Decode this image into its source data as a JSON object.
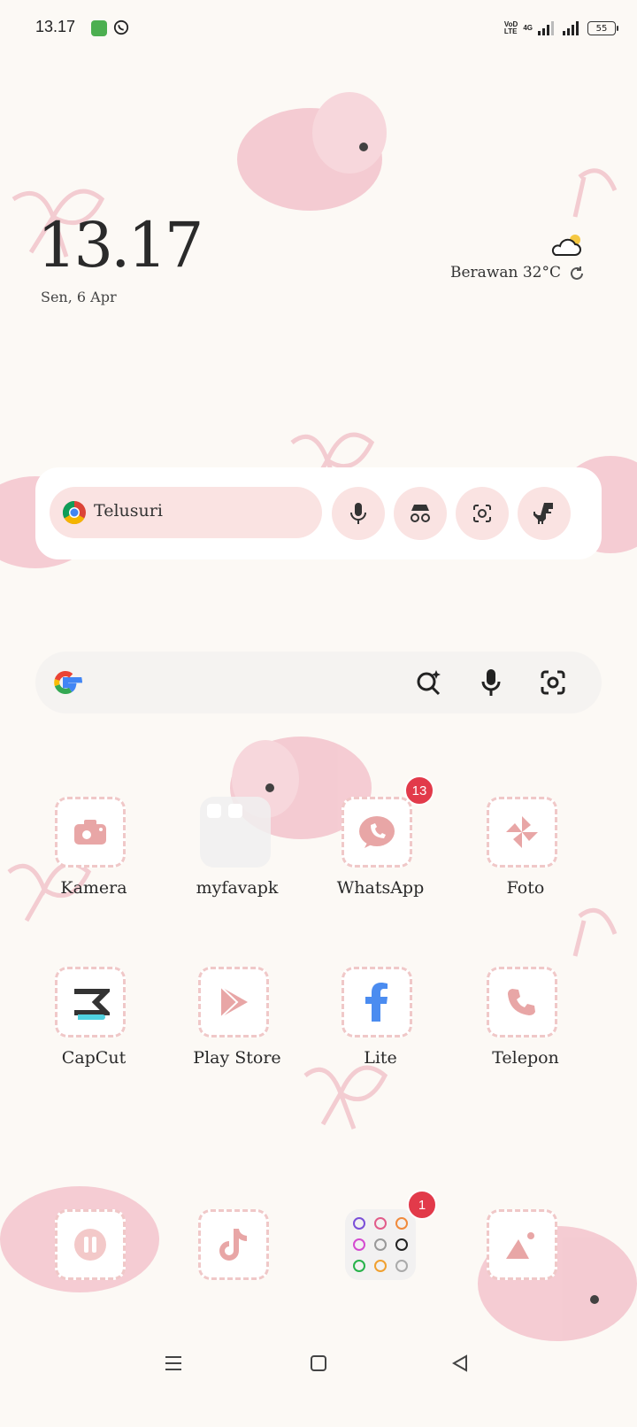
{
  "status_bar": {
    "time": "13.17",
    "volte_top": "VoD",
    "volte_bottom": "LTE",
    "network": "4G",
    "battery": "55"
  },
  "clock_widget": {
    "time": "13.17",
    "date": "Sen, 6 Apr",
    "weather": "Berawan 32°C"
  },
  "chrome_widget": {
    "search_label": "Telusuri",
    "buttons": [
      "mic-icon",
      "incognito-icon",
      "lens-icon",
      "dino-icon"
    ]
  },
  "google_bar": {
    "buttons": [
      "ai-search-icon",
      "mic-icon",
      "lens-icon"
    ]
  },
  "apps": [
    {
      "label": "Kamera",
      "icon": "camera-icon"
    },
    {
      "label": "myfavapk",
      "icon": "folder-icon"
    },
    {
      "label": "WhatsApp",
      "icon": "whatsapp-icon",
      "badge": "13"
    },
    {
      "label": "Foto",
      "icon": "pinwheel-icon"
    },
    {
      "label": "CapCut",
      "icon": "capcut-icon"
    },
    {
      "label": "Play Store",
      "icon": "play-store-icon"
    },
    {
      "label": "Lite",
      "icon": "facebook-icon"
    },
    {
      "label": "Telepon",
      "icon": "phone-icon"
    }
  ],
  "dock": [
    {
      "icon": "pause-icon"
    },
    {
      "icon": "tiktok-icon"
    },
    {
      "icon": "folder-icon",
      "badge": "1"
    },
    {
      "icon": "gallery-icon"
    }
  ],
  "nav": [
    "menu-icon",
    "home-icon",
    "back-icon"
  ],
  "colors": {
    "background": "#fcf9f5",
    "accent_pink": "#e8a6a6",
    "badge": "#e23a4a",
    "facebook": "#4b8cf0"
  }
}
